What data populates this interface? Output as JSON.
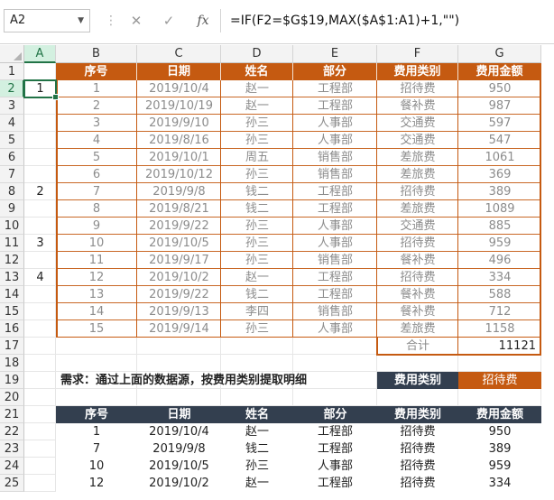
{
  "formula_bar": {
    "name_box": "A2",
    "cancel_icon": "✕",
    "enter_icon": "✓",
    "fx_label": "fx",
    "formula": "=IF(F2=$G$19,MAX($A$1:A1)+1,\"\")"
  },
  "columns": [
    "A",
    "B",
    "C",
    "D",
    "E",
    "F",
    "G"
  ],
  "rows": [
    "1",
    "2",
    "3",
    "4",
    "5",
    "6",
    "7",
    "8",
    "9",
    "10",
    "11",
    "12",
    "13",
    "14",
    "15",
    "16",
    "17",
    "18",
    "19",
    "20",
    "21",
    "22",
    "23",
    "24",
    "25"
  ],
  "helper_col_a": {
    "2": "1",
    "8": "2",
    "11": "3",
    "13": "4"
  },
  "source_table": {
    "headers": [
      "序号",
      "日期",
      "姓名",
      "部分",
      "费用类别",
      "费用金额"
    ],
    "rows": [
      [
        "1",
        "2019/10/4",
        "赵一",
        "工程部",
        "招待费",
        "950"
      ],
      [
        "2",
        "2019/10/19",
        "赵一",
        "工程部",
        "餐补费",
        "987"
      ],
      [
        "3",
        "2019/9/10",
        "孙三",
        "人事部",
        "交通费",
        "597"
      ],
      [
        "4",
        "2019/8/16",
        "孙三",
        "人事部",
        "交通费",
        "547"
      ],
      [
        "5",
        "2019/10/1",
        "周五",
        "销售部",
        "差旅费",
        "1061"
      ],
      [
        "6",
        "2019/10/12",
        "孙三",
        "销售部",
        "差旅费",
        "369"
      ],
      [
        "7",
        "2019/9/8",
        "钱二",
        "工程部",
        "招待费",
        "389"
      ],
      [
        "8",
        "2019/8/21",
        "钱二",
        "工程部",
        "差旅费",
        "1089"
      ],
      [
        "9",
        "2019/9/22",
        "孙三",
        "人事部",
        "交通费",
        "885"
      ],
      [
        "10",
        "2019/10/5",
        "孙三",
        "人事部",
        "招待费",
        "959"
      ],
      [
        "11",
        "2019/9/17",
        "孙三",
        "销售部",
        "餐补费",
        "496"
      ],
      [
        "12",
        "2019/10/2",
        "赵一",
        "工程部",
        "招待费",
        "334"
      ],
      [
        "13",
        "2019/9/22",
        "钱二",
        "工程部",
        "餐补费",
        "588"
      ],
      [
        "14",
        "2019/9/13",
        "李四",
        "销售部",
        "餐补费",
        "712"
      ],
      [
        "15",
        "2019/9/14",
        "孙三",
        "人事部",
        "差旅费",
        "1158"
      ]
    ],
    "total_label": "合计",
    "total_value": "11121"
  },
  "requirement": {
    "text": "需求：通过上面的数据源，按费用类别提取明细",
    "criteria_label": "费用类别",
    "criteria_value": "招待费"
  },
  "result_table": {
    "headers": [
      "序号",
      "日期",
      "姓名",
      "部分",
      "费用类别",
      "费用金额"
    ],
    "rows": [
      [
        "1",
        "2019/10/4",
        "赵一",
        "工程部",
        "招待费",
        "950"
      ],
      [
        "7",
        "2019/9/8",
        "钱二",
        "工程部",
        "招待费",
        "389"
      ],
      [
        "10",
        "2019/10/5",
        "孙三",
        "人事部",
        "招待费",
        "959"
      ],
      [
        "12",
        "2019/10/2",
        "赵一",
        "工程部",
        "招待费",
        "334"
      ]
    ]
  },
  "colors": {
    "orange": "#c55a11",
    "dark": "#333f4f",
    "excel_green": "#217346"
  }
}
